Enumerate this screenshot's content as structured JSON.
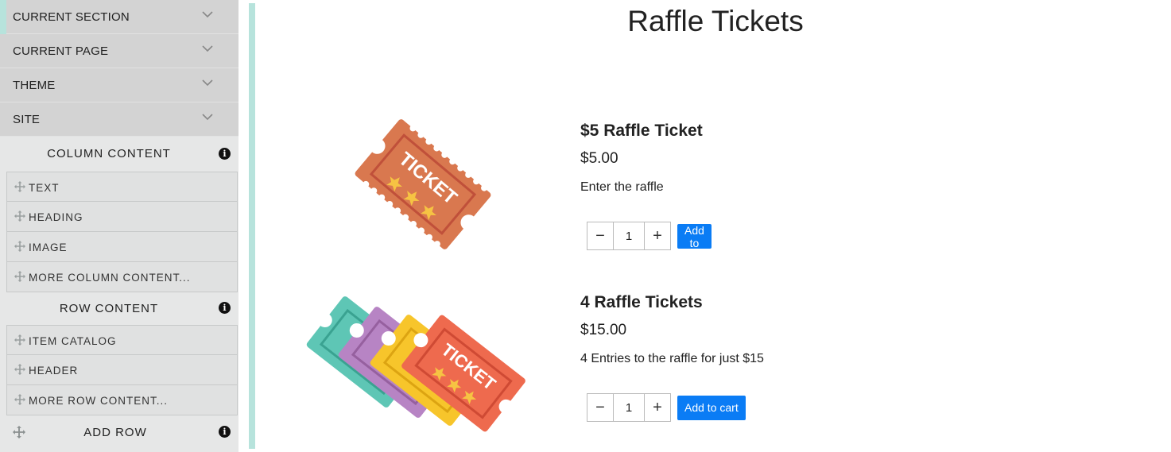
{
  "sidebar": {
    "accordion": [
      {
        "label": "CURRENT SECTION"
      },
      {
        "label": "CURRENT PAGE"
      },
      {
        "label": "THEME"
      },
      {
        "label": "SITE"
      }
    ],
    "column_content": {
      "title": "COLUMN CONTENT",
      "items": [
        {
          "label": "TEXT"
        },
        {
          "label": "HEADING"
        },
        {
          "label": "IMAGE"
        },
        {
          "label": "MORE COLUMN CONTENT..."
        }
      ]
    },
    "row_content": {
      "title": "ROW CONTENT",
      "items": [
        {
          "label": "ITEM CATALOG"
        },
        {
          "label": "HEADER"
        },
        {
          "label": "MORE ROW CONTENT..."
        }
      ]
    },
    "add_row": {
      "label": "ADD ROW"
    },
    "info_glyph": "i"
  },
  "main": {
    "title": "Raffle Tickets",
    "products": [
      {
        "name": "$5 Raffle Ticket",
        "price": "$5.00",
        "description": "Enter the raffle",
        "quantity": "1",
        "button": "Add to cart",
        "image_text": "TICKET"
      },
      {
        "name": "4 Raffle Tickets",
        "price": "$15.00",
        "description": "4 Entries to the raffle for just $15",
        "quantity": "1",
        "button": "Add to cart",
        "image_text": "TICKET"
      }
    ]
  },
  "stepper": {
    "minus": "−",
    "plus": "+"
  },
  "colors": {
    "accent": "#b7e3dc",
    "button_blue": "#0a7cf5",
    "ticket_orange": "#d9784f",
    "ticket_teal": "#5ec6b5",
    "ticket_purple": "#b784c4",
    "ticket_yellow": "#f7c52b",
    "ticket_red": "#ee6a4e"
  }
}
